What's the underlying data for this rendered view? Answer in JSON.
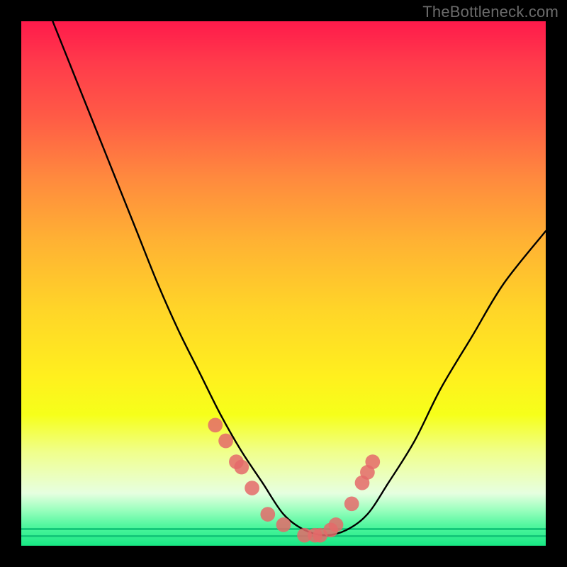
{
  "watermark": "TheBottleneck.com",
  "chart_data": {
    "type": "line",
    "title": "",
    "xlabel": "",
    "ylabel": "",
    "xlim": [
      0,
      100
    ],
    "ylim": [
      0,
      100
    ],
    "grid": false,
    "legend": false,
    "series": [
      {
        "name": "bottleneck-curve",
        "stroke": "#000000",
        "x": [
          6,
          10,
          14,
          18,
          22,
          26,
          30,
          34,
          38,
          42,
          46,
          50,
          54,
          58,
          62,
          66,
          70,
          75,
          80,
          86,
          92,
          100
        ],
        "y": [
          100,
          90,
          80,
          70,
          60,
          50,
          41,
          33,
          25,
          18,
          12,
          6,
          3,
          2,
          3,
          6,
          12,
          20,
          30,
          40,
          50,
          60
        ]
      }
    ],
    "markers": {
      "name": "highlight-points",
      "color": "#e46a6a",
      "radius_pct": 1.4,
      "x": [
        37,
        39,
        41,
        42,
        44,
        47,
        50,
        54,
        56,
        57,
        59,
        60,
        63,
        65,
        66,
        67
      ],
      "y": [
        23,
        20,
        16,
        15,
        11,
        6,
        4,
        2,
        2,
        2,
        3,
        4,
        8,
        12,
        14,
        16
      ]
    },
    "background_gradient": {
      "top": "#ff1a4b",
      "bottom": "#18e884",
      "stops": [
        "red",
        "orange",
        "yellow",
        "light-yellow",
        "green"
      ]
    }
  }
}
